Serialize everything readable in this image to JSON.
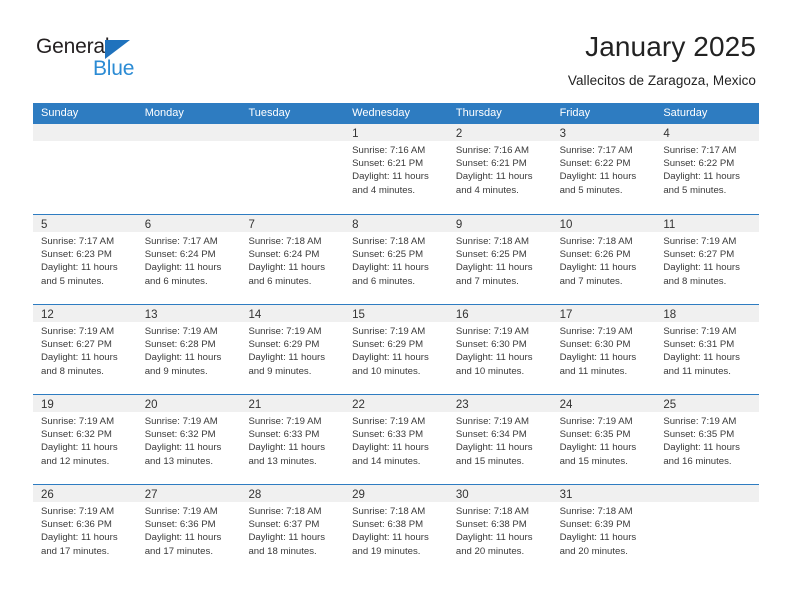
{
  "brand": {
    "name_top": "General",
    "name_bottom": "Blue",
    "triangle_color": "#1f72bd",
    "blue_color": "#2b8bd4"
  },
  "header": {
    "title": "January 2025",
    "subtitle": "Vallecitos de Zaragoza, Mexico"
  },
  "colors": {
    "header_blue": "#2e7cc1",
    "day_band_gray": "#f0f0f0",
    "text": "#3a3a3a"
  },
  "weekdays": [
    "Sunday",
    "Monday",
    "Tuesday",
    "Wednesday",
    "Thursday",
    "Friday",
    "Saturday"
  ],
  "weeks": [
    [
      {
        "day": ""
      },
      {
        "day": ""
      },
      {
        "day": ""
      },
      {
        "day": "1",
        "sunrise": "Sunrise: 7:16 AM",
        "sunset": "Sunset: 6:21 PM",
        "daylight_1": "Daylight: 11 hours",
        "daylight_2": "and 4 minutes."
      },
      {
        "day": "2",
        "sunrise": "Sunrise: 7:16 AM",
        "sunset": "Sunset: 6:21 PM",
        "daylight_1": "Daylight: 11 hours",
        "daylight_2": "and 4 minutes."
      },
      {
        "day": "3",
        "sunrise": "Sunrise: 7:17 AM",
        "sunset": "Sunset: 6:22 PM",
        "daylight_1": "Daylight: 11 hours",
        "daylight_2": "and 5 minutes."
      },
      {
        "day": "4",
        "sunrise": "Sunrise: 7:17 AM",
        "sunset": "Sunset: 6:22 PM",
        "daylight_1": "Daylight: 11 hours",
        "daylight_2": "and 5 minutes."
      }
    ],
    [
      {
        "day": "5",
        "sunrise": "Sunrise: 7:17 AM",
        "sunset": "Sunset: 6:23 PM",
        "daylight_1": "Daylight: 11 hours",
        "daylight_2": "and 5 minutes."
      },
      {
        "day": "6",
        "sunrise": "Sunrise: 7:17 AM",
        "sunset": "Sunset: 6:24 PM",
        "daylight_1": "Daylight: 11 hours",
        "daylight_2": "and 6 minutes."
      },
      {
        "day": "7",
        "sunrise": "Sunrise: 7:18 AM",
        "sunset": "Sunset: 6:24 PM",
        "daylight_1": "Daylight: 11 hours",
        "daylight_2": "and 6 minutes."
      },
      {
        "day": "8",
        "sunrise": "Sunrise: 7:18 AM",
        "sunset": "Sunset: 6:25 PM",
        "daylight_1": "Daylight: 11 hours",
        "daylight_2": "and 6 minutes."
      },
      {
        "day": "9",
        "sunrise": "Sunrise: 7:18 AM",
        "sunset": "Sunset: 6:25 PM",
        "daylight_1": "Daylight: 11 hours",
        "daylight_2": "and 7 minutes."
      },
      {
        "day": "10",
        "sunrise": "Sunrise: 7:18 AM",
        "sunset": "Sunset: 6:26 PM",
        "daylight_1": "Daylight: 11 hours",
        "daylight_2": "and 7 minutes."
      },
      {
        "day": "11",
        "sunrise": "Sunrise: 7:19 AM",
        "sunset": "Sunset: 6:27 PM",
        "daylight_1": "Daylight: 11 hours",
        "daylight_2": "and 8 minutes."
      }
    ],
    [
      {
        "day": "12",
        "sunrise": "Sunrise: 7:19 AM",
        "sunset": "Sunset: 6:27 PM",
        "daylight_1": "Daylight: 11 hours",
        "daylight_2": "and 8 minutes."
      },
      {
        "day": "13",
        "sunrise": "Sunrise: 7:19 AM",
        "sunset": "Sunset: 6:28 PM",
        "daylight_1": "Daylight: 11 hours",
        "daylight_2": "and 9 minutes."
      },
      {
        "day": "14",
        "sunrise": "Sunrise: 7:19 AM",
        "sunset": "Sunset: 6:29 PM",
        "daylight_1": "Daylight: 11 hours",
        "daylight_2": "and 9 minutes."
      },
      {
        "day": "15",
        "sunrise": "Sunrise: 7:19 AM",
        "sunset": "Sunset: 6:29 PM",
        "daylight_1": "Daylight: 11 hours",
        "daylight_2": "and 10 minutes."
      },
      {
        "day": "16",
        "sunrise": "Sunrise: 7:19 AM",
        "sunset": "Sunset: 6:30 PM",
        "daylight_1": "Daylight: 11 hours",
        "daylight_2": "and 10 minutes."
      },
      {
        "day": "17",
        "sunrise": "Sunrise: 7:19 AM",
        "sunset": "Sunset: 6:30 PM",
        "daylight_1": "Daylight: 11 hours",
        "daylight_2": "and 11 minutes."
      },
      {
        "day": "18",
        "sunrise": "Sunrise: 7:19 AM",
        "sunset": "Sunset: 6:31 PM",
        "daylight_1": "Daylight: 11 hours",
        "daylight_2": "and 11 minutes."
      }
    ],
    [
      {
        "day": "19",
        "sunrise": "Sunrise: 7:19 AM",
        "sunset": "Sunset: 6:32 PM",
        "daylight_1": "Daylight: 11 hours",
        "daylight_2": "and 12 minutes."
      },
      {
        "day": "20",
        "sunrise": "Sunrise: 7:19 AM",
        "sunset": "Sunset: 6:32 PM",
        "daylight_1": "Daylight: 11 hours",
        "daylight_2": "and 13 minutes."
      },
      {
        "day": "21",
        "sunrise": "Sunrise: 7:19 AM",
        "sunset": "Sunset: 6:33 PM",
        "daylight_1": "Daylight: 11 hours",
        "daylight_2": "and 13 minutes."
      },
      {
        "day": "22",
        "sunrise": "Sunrise: 7:19 AM",
        "sunset": "Sunset: 6:33 PM",
        "daylight_1": "Daylight: 11 hours",
        "daylight_2": "and 14 minutes."
      },
      {
        "day": "23",
        "sunrise": "Sunrise: 7:19 AM",
        "sunset": "Sunset: 6:34 PM",
        "daylight_1": "Daylight: 11 hours",
        "daylight_2": "and 15 minutes."
      },
      {
        "day": "24",
        "sunrise": "Sunrise: 7:19 AM",
        "sunset": "Sunset: 6:35 PM",
        "daylight_1": "Daylight: 11 hours",
        "daylight_2": "and 15 minutes."
      },
      {
        "day": "25",
        "sunrise": "Sunrise: 7:19 AM",
        "sunset": "Sunset: 6:35 PM",
        "daylight_1": "Daylight: 11 hours",
        "daylight_2": "and 16 minutes."
      }
    ],
    [
      {
        "day": "26",
        "sunrise": "Sunrise: 7:19 AM",
        "sunset": "Sunset: 6:36 PM",
        "daylight_1": "Daylight: 11 hours",
        "daylight_2": "and 17 minutes."
      },
      {
        "day": "27",
        "sunrise": "Sunrise: 7:19 AM",
        "sunset": "Sunset: 6:36 PM",
        "daylight_1": "Daylight: 11 hours",
        "daylight_2": "and 17 minutes."
      },
      {
        "day": "28",
        "sunrise": "Sunrise: 7:18 AM",
        "sunset": "Sunset: 6:37 PM",
        "daylight_1": "Daylight: 11 hours",
        "daylight_2": "and 18 minutes."
      },
      {
        "day": "29",
        "sunrise": "Sunrise: 7:18 AM",
        "sunset": "Sunset: 6:38 PM",
        "daylight_1": "Daylight: 11 hours",
        "daylight_2": "and 19 minutes."
      },
      {
        "day": "30",
        "sunrise": "Sunrise: 7:18 AM",
        "sunset": "Sunset: 6:38 PM",
        "daylight_1": "Daylight: 11 hours",
        "daylight_2": "and 20 minutes."
      },
      {
        "day": "31",
        "sunrise": "Sunrise: 7:18 AM",
        "sunset": "Sunset: 6:39 PM",
        "daylight_1": "Daylight: 11 hours",
        "daylight_2": "and 20 minutes."
      },
      {
        "day": ""
      }
    ]
  ]
}
